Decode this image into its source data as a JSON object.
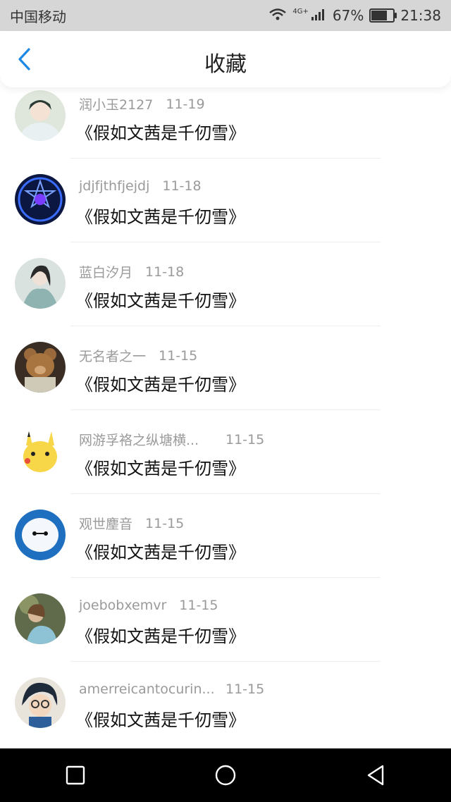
{
  "status_bar": {
    "carrier": "中国移动",
    "network": "4G+",
    "battery": "67%",
    "battery_level": 0.67,
    "time": "21:38"
  },
  "header": {
    "title": "收藏",
    "back_icon": "chevron-left-icon",
    "accent": "#1e88e5"
  },
  "items": [
    {
      "user": "润小玉2127",
      "date": "11-19",
      "book": "《假如文茜是千仞雪》"
    },
    {
      "user": "jdjfjthfjejdj",
      "date": "11-18",
      "book": "《假如文茜是千仞雪》"
    },
    {
      "user": "蓝白汐月",
      "date": "11-18",
      "book": "《假如文茜是千仞雪》"
    },
    {
      "user": "无名者之一",
      "date": "11-15",
      "book": "《假如文茜是千仞雪》"
    },
    {
      "user": "网游孚袼之纵塘横...",
      "date": "11-15",
      "book": "《假如文茜是千仞雪》"
    },
    {
      "user": "观世麈音",
      "date": "11-15",
      "book": "《假如文茜是千仞雪》"
    },
    {
      "user": "joebobxemvr",
      "date": "11-15",
      "book": "《假如文茜是千仞雪》"
    },
    {
      "user": "amerreicantocurin...",
      "date": "11-15",
      "book": "《假如文茜是千仞雪》"
    }
  ],
  "nav_bar": {
    "recents_icon": "square-icon",
    "home_icon": "circle-icon",
    "back_icon": "triangle-back-icon"
  }
}
